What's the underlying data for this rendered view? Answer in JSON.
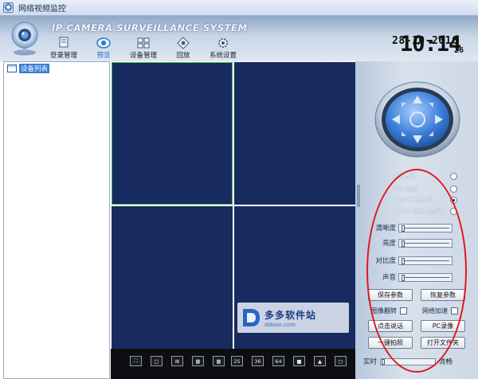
{
  "window": {
    "title": "网络视频监控"
  },
  "header": {
    "banner_text": "IP CAMERA SURVEILLANCE SYSTEM",
    "nav": [
      {
        "label": "登录管理",
        "icon": "login-icon"
      },
      {
        "label": "预览",
        "icon": "preview-icon",
        "active": true
      },
      {
        "label": "设备管理",
        "icon": "device-manage-icon"
      },
      {
        "label": "回放",
        "icon": "playback-icon"
      },
      {
        "label": "系统设置",
        "icon": "settings-icon"
      }
    ],
    "clock": {
      "date": "28-10-2016",
      "time": "10:14",
      "seconds": "26"
    }
  },
  "device_list": {
    "root_label": "设备列表"
  },
  "layout_buttons": [
    "⛶",
    "□",
    "⊞",
    "▦",
    "25",
    "36",
    "64",
    "■",
    "▲",
    "◻"
  ],
  "resolution": {
    "options": [
      {
        "label": "CIF标清",
        "selected": false
      },
      {
        "label": "VGA高清",
        "selected": false
      },
      {
        "label": "720P百万高清",
        "selected": true
      },
      {
        "label": "1080P两百万高清",
        "selected": false
      }
    ]
  },
  "image": {
    "brightness_label": "清晰度",
    "luma_label": "亮度",
    "contrast_label": "对比度",
    "volume_label": "声音",
    "brightness_value": 0.02,
    "luma_value": 0.02,
    "contrast_value": 0.02,
    "volume_value": 0.02
  },
  "buttons": {
    "save_params": "保存参数",
    "restore_params": "恢复参数",
    "talk": "点击说话",
    "pc_record": "PC录像",
    "snapshot": "一键拍照",
    "open_folder": "打开文件夹"
  },
  "checks": {
    "flip_label": "图像翻转",
    "accel_label": "网络加速"
  },
  "stream": {
    "realtime_label": "实时",
    "smooth_label": "流畅"
  },
  "watermark": {
    "name": "多多软件站",
    "url": "ddooo.com"
  },
  "colors": {
    "video_cell": "#172b61",
    "selected_outline": "#3fbf3f",
    "annotation": "#e0181a"
  }
}
